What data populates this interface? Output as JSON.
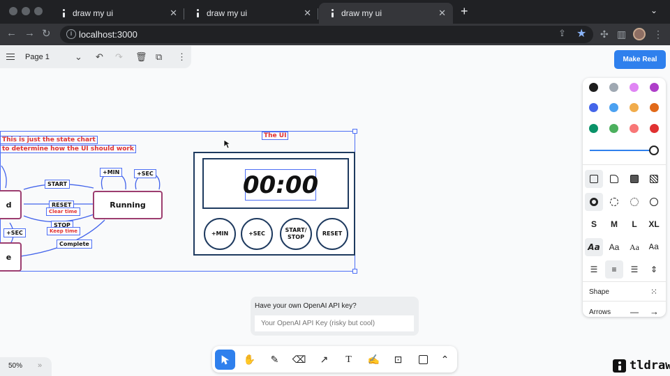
{
  "browser": {
    "tabs": [
      {
        "title": "draw my ui",
        "active": false
      },
      {
        "title": "draw my ui",
        "active": false
      },
      {
        "title": "draw my ui",
        "active": true
      }
    ],
    "url": "localhost:3000"
  },
  "menu": {
    "page_name": "Page 1"
  },
  "make_real": {
    "label": "Make Real"
  },
  "style_panel": {
    "colors": [
      "#1d1d1d",
      "#9fa8b2",
      "#e085f4",
      "#ae3ec9",
      "#4465e9",
      "#4ba1f1",
      "#f1ac4b",
      "#e16919",
      "#099268",
      "#4cb05e",
      "#f87777",
      "#e03131"
    ],
    "sizes": [
      "S",
      "M",
      "L",
      "XL"
    ],
    "font_sample": "Aa",
    "shape_label": "Shape",
    "arrows_label": "Arrows"
  },
  "canvas": {
    "note_line1": "This is just the state chart",
    "note_line2": "to determine how the UI should work",
    "ui_label": "The UI",
    "states": {
      "left": "d",
      "running": "Running",
      "bottom": "e"
    },
    "chips": {
      "start": "START",
      "reset": "RESET",
      "clear_time": "Clear time",
      "stop": "STOP",
      "keep_time": "Keep time",
      "complete": "Complete",
      "plus_min": "+MIN",
      "plus_sec": "+SEC",
      "plus_sec_left": "+SEC"
    },
    "timer": {
      "display": "00:00",
      "buttons": [
        "+MIN",
        "+SEC",
        "START/\nSTOP",
        "RESET"
      ]
    }
  },
  "api": {
    "question": "Have your own OpenAI API key?",
    "placeholder": "Your OpenAI API Key (risky but cool)"
  },
  "zoom": {
    "level": "50%"
  },
  "brand": {
    "name": "tldraw"
  }
}
